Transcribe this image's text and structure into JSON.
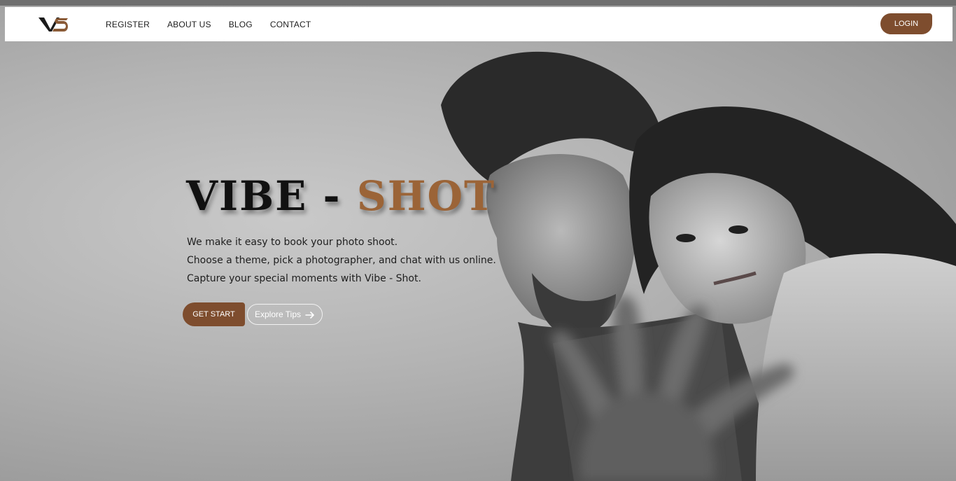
{
  "header": {
    "logo_text": "VS",
    "nav": [
      {
        "label": "REGISTER"
      },
      {
        "label": "ABOUT US"
      },
      {
        "label": "BLOG"
      },
      {
        "label": "CONTACT"
      }
    ],
    "login_label": "LOGIN"
  },
  "hero": {
    "title_main": "VIBE -",
    "title_accent": "SHOT",
    "lines": [
      "We make it easy to book your photo shoot.",
      "Choose a theme, pick a photographer, and chat with us online.",
      "Capture your special moments with Vibe - Shot."
    ],
    "primary_button": "GET START",
    "secondary_button": "Explore Tips",
    "secondary_icon": "arrow-right-icon"
  },
  "colors": {
    "brand_brown": "#7e4d2e",
    "accent_text": "#9b6437"
  }
}
